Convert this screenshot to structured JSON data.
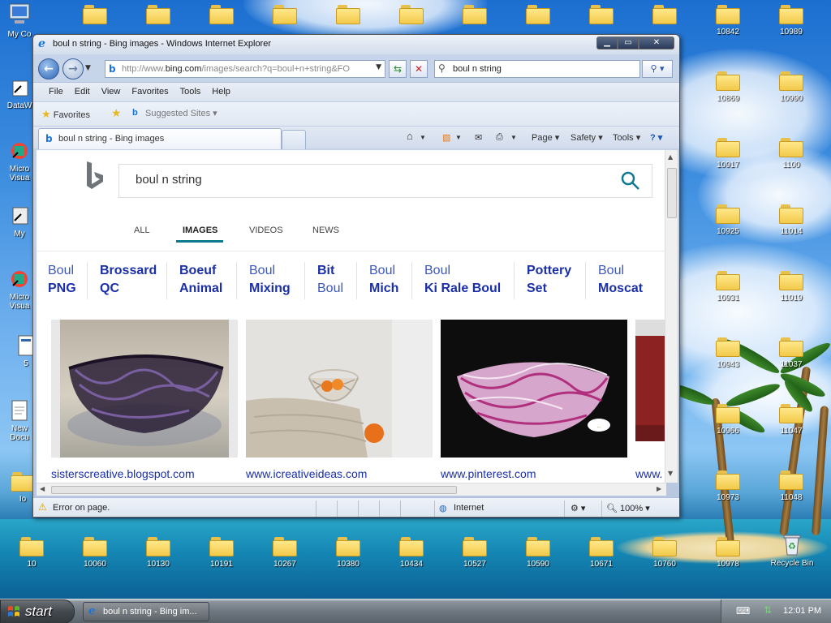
{
  "desktop": {
    "left_icons": [
      {
        "label": "My Co",
        "icon": "my-computer-icon"
      },
      {
        "label": "DataW",
        "icon": "shortcut-icon"
      },
      {
        "label": "Micro",
        "label2": "Visua",
        "icon": "shortcut-icon"
      },
      {
        "label": "My",
        "icon": "shortcut-icon"
      },
      {
        "label": "Micro",
        "label2": "Visua",
        "icon": "shortcut-icon"
      },
      {
        "label": "5",
        "icon": "document-icon"
      },
      {
        "label": "New",
        "label2": "Docu",
        "icon": "document-icon"
      },
      {
        "label": "Io",
        "icon": "folder-icon"
      }
    ],
    "top_row_folders": [
      "",
      "",
      "",
      "",
      "",
      "",
      "",
      "",
      "",
      ""
    ],
    "right_col1": [
      "10842",
      "10869",
      "10917",
      "10925",
      "10931",
      "10943",
      "10966",
      "10973"
    ],
    "right_col2": [
      "10989",
      "10990",
      "1100",
      "11014",
      "11019",
      "11037",
      "11047",
      "11048"
    ],
    "bottom_row": [
      "10",
      "10060",
      "10130",
      "10191",
      "10267",
      "10380",
      "10434",
      "10527",
      "10590",
      "10671",
      "10760",
      "10978"
    ],
    "recycle_bin": "Recycle Bin"
  },
  "window": {
    "title": "boul n string - Bing images - Windows Internet Explorer",
    "address": {
      "prefix": "http://www.",
      "host": "bing.com",
      "path": "/images/search?q=boul+n+string&FO"
    },
    "search_value": "boul n string",
    "menu": [
      "File",
      "Edit",
      "View",
      "Favorites",
      "Tools",
      "Help"
    ],
    "favorites_label": "Favorites",
    "suggested_sites": "Suggested Sites",
    "tab_title": "boul n string - Bing images",
    "commands": {
      "page": "Page",
      "safety": "Safety",
      "tools": "Tools"
    },
    "status_text": "Error on page.",
    "zone": "Internet",
    "zoom": "100%"
  },
  "bing": {
    "query": "boul n string",
    "tabs": [
      "ALL",
      "IMAGES",
      "VIDEOS",
      "NEWS"
    ],
    "active_tab": "IMAGES",
    "related": [
      {
        "l1": "Boul",
        "l2": "PNG",
        "style": "norm-bold"
      },
      {
        "l1": "Brossard",
        "l2": "QC",
        "style": "bold-bold"
      },
      {
        "l1": "Boeuf",
        "l2": "Animal",
        "style": "bold-bold"
      },
      {
        "l1": "Boul",
        "l2": "Mixing",
        "style": "norm-bold"
      },
      {
        "l1": "Bit",
        "l2": "Boul",
        "style": "bold-norm"
      },
      {
        "l1": "Boul",
        "l2": "Mich",
        "style": "norm-bold"
      },
      {
        "l1": "Boul",
        "l2": "Ki Rale Boul",
        "style": "norm-bold"
      },
      {
        "l1": "Pottery",
        "l2": "Set",
        "style": "bold-bold"
      },
      {
        "l1": "Boul",
        "l2": "Moscat",
        "style": "norm-bold"
      }
    ],
    "results": [
      {
        "source": "sisterscreative.blogspot.com",
        "desc": "purple-string-bowl"
      },
      {
        "source": "www.icreativeideas.com",
        "desc": "white-string-bowl-oranges"
      },
      {
        "source": "www.pinterest.com",
        "desc": "pink-string-bowl"
      },
      {
        "source": "www.",
        "desc": "partial-result"
      }
    ]
  },
  "taskbar": {
    "start_label": "start",
    "task_label": "boul n string - Bing im...",
    "clock": "12:01 PM"
  },
  "colors": {
    "bing_teal": "#0f7a8f",
    "link_blue": "#1a2fa8",
    "folder_yellow": "#f2c94a"
  }
}
